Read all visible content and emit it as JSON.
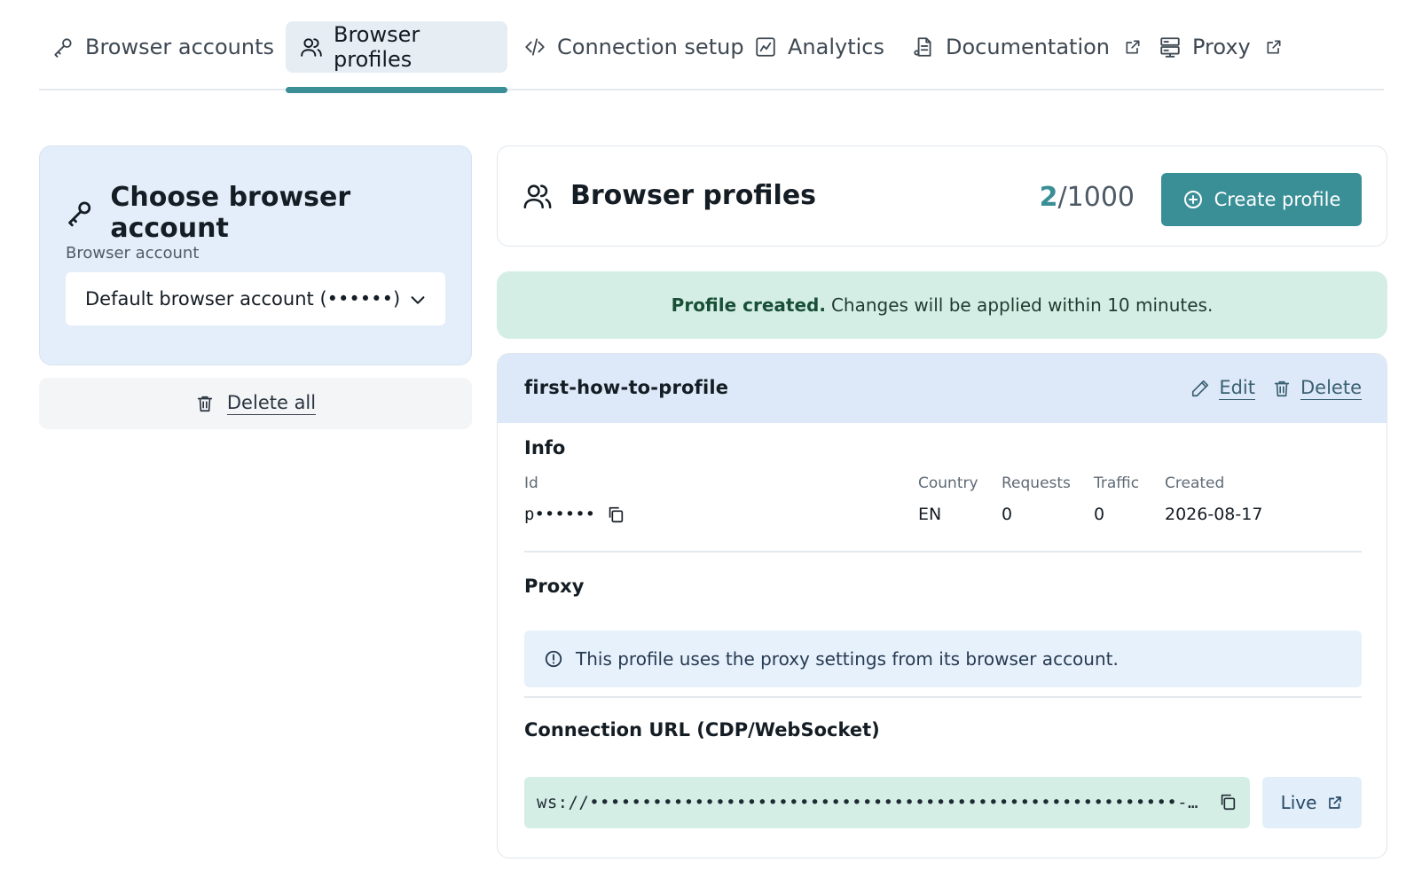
{
  "tabs": [
    {
      "label": "Browser accounts",
      "icon": "key-icon"
    },
    {
      "label": "Browser profiles",
      "icon": "users-icon",
      "active": true
    },
    {
      "label": "Connection setup",
      "icon": "code-icon"
    },
    {
      "label": "Analytics",
      "icon": "chart-icon"
    },
    {
      "label": "Documentation",
      "icon": "document-icon",
      "external": true
    },
    {
      "label": "Proxy",
      "icon": "server-icon",
      "external": true
    }
  ],
  "account_card": {
    "title": "Choose browser account",
    "field_label": "Browser account",
    "selected_value": "Default browser account (••••••)",
    "delete_all_label": "Delete all"
  },
  "profiles_header": {
    "title": "Browser profiles",
    "count_current": "2",
    "count_max": "/1000",
    "create_button": "Create profile"
  },
  "banner": {
    "bold": "Profile created.",
    "text": "Changes will be applied within 10 minutes."
  },
  "profile": {
    "name": "first-how-to-profile",
    "edit_label": "Edit",
    "delete_label": "Delete",
    "info_title": "Info",
    "id_label": "Id",
    "id_value": "p••••••",
    "country_label": "Country",
    "country_value": "EN",
    "requests_label": "Requests",
    "requests_value": "0",
    "traffic_label": "Traffic",
    "traffic_value": "0",
    "created_label": "Created",
    "created_value": "2026-08-17",
    "proxy_title": "Proxy",
    "proxy_notice": "This profile uses the proxy settings from its browser account.",
    "connection_title": "Connection URL (CDP/WebSocket)",
    "connection_url": "ws://••••••••••••••••••••••••••••••••••••••••••••••••••••••••-…",
    "live_label": "Live"
  },
  "colors": {
    "accent": "#3a8f97",
    "success_bg": "#d4eee6",
    "info_bg": "#e7f1fb",
    "panel_bg": "#e4eefa"
  }
}
